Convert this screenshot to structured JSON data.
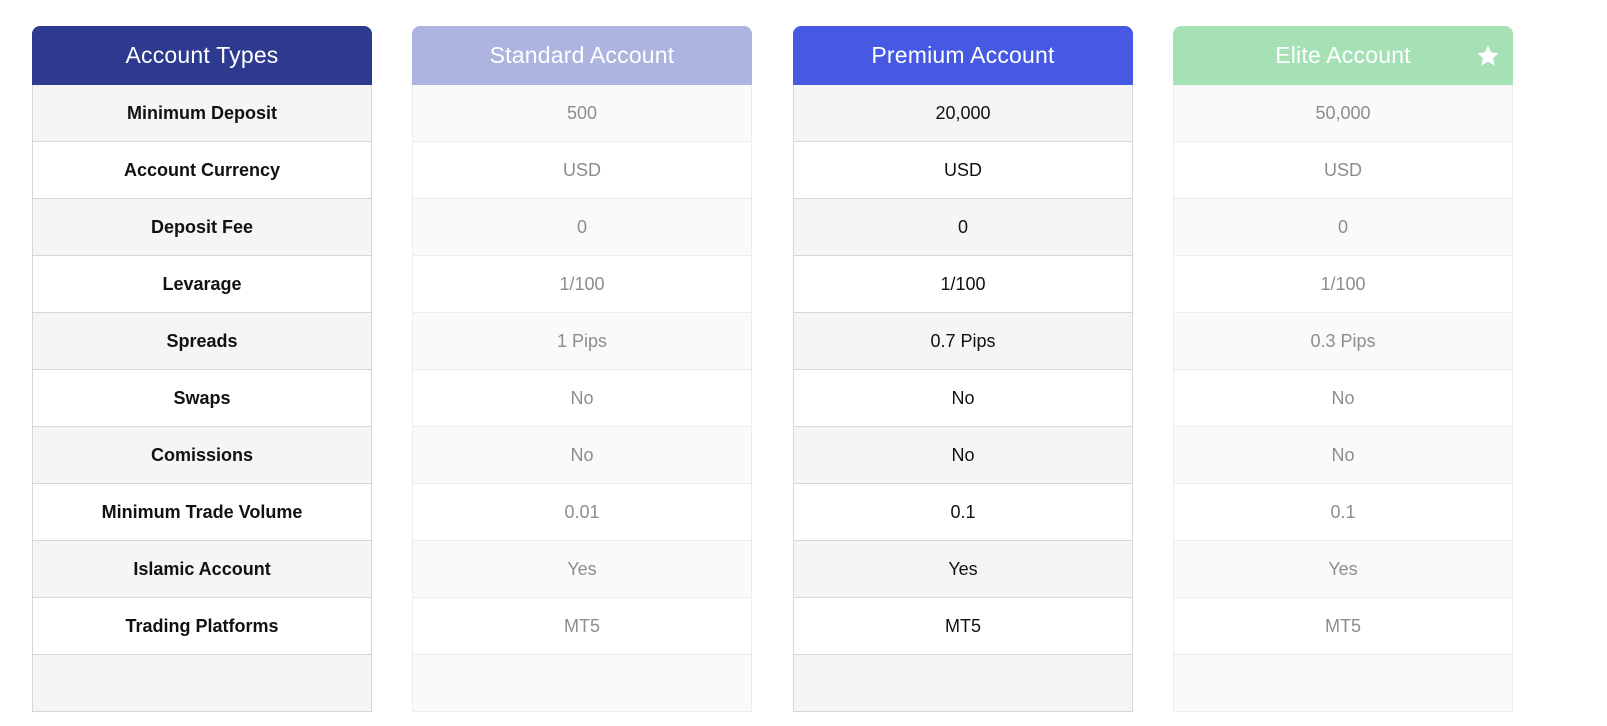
{
  "colors": {
    "labels_header": "#2d3a8f",
    "standard_header": "#adb4e0",
    "premium_header": "#4659e3",
    "elite_header": "#a6e1b6"
  },
  "labels": {
    "header": "Account Types",
    "rows": [
      "Minimum Deposit",
      "Account Currency",
      "Deposit Fee",
      "Levarage",
      "Spreads",
      "Swaps",
      "Comissions",
      "Minimum Trade Volume",
      "Islamic Account",
      "Trading Platforms"
    ]
  },
  "standard": {
    "header": "Standard Account",
    "values": [
      "500",
      "USD",
      "0",
      "1/100",
      "1 Pips",
      "No",
      "No",
      "0.01",
      "Yes",
      "MT5"
    ]
  },
  "premium": {
    "header": "Premium Account",
    "values": [
      "20,000",
      "USD",
      "0",
      "1/100",
      "0.7 Pips",
      "No",
      "No",
      "0.1",
      "Yes",
      "MT5"
    ]
  },
  "elite": {
    "header": "Elite Account",
    "header_icon": "star-icon",
    "values": [
      "50,000",
      "USD",
      "0",
      "1/100",
      "0.3 Pips",
      "No",
      "No",
      "0.1",
      "Yes",
      "MT5"
    ]
  }
}
